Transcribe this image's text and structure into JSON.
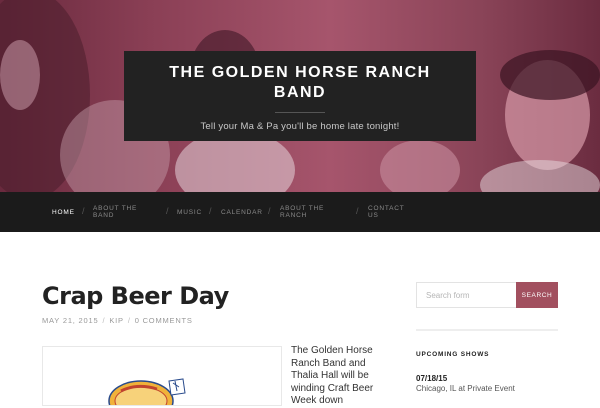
{
  "site": {
    "title_line1": "THE GOLDEN HORSE RANCH",
    "title_line2": "BAND",
    "tagline": "Tell your Ma & Pa you'll be home late tonight!"
  },
  "nav": {
    "items": [
      {
        "label": "HOME",
        "active": true
      },
      {
        "label_line1": "ABOUT THE",
        "label_line2": "BAND"
      },
      {
        "label": "MUSIC"
      },
      {
        "label": "CALENDAR"
      },
      {
        "label_line1": "ABOUT THE",
        "label_line2": "RANCH"
      },
      {
        "label_line1": "CONTACT",
        "label_line2": "US"
      }
    ]
  },
  "post": {
    "title": "Crap Beer Day",
    "date": "MAY 21, 2015",
    "author": "KIP",
    "comments": "0 COMMENTS",
    "excerpt": "The Golden Horse Ranch Band and Thalia Hall will be winding Craft Beer Week down"
  },
  "sidebar": {
    "search": {
      "placeholder": "Search form",
      "button_label": "SEARCH"
    },
    "upcoming": {
      "title": "UPCOMING SHOWS",
      "shows": [
        {
          "date": "07/18/15",
          "description": "Chicago, IL at Private Event"
        }
      ]
    }
  },
  "colors": {
    "nav_bg": "#1b1b1b",
    "title_box_bg": "#222222",
    "accent": "#a2505f",
    "header_tint": "#8a3f55"
  }
}
